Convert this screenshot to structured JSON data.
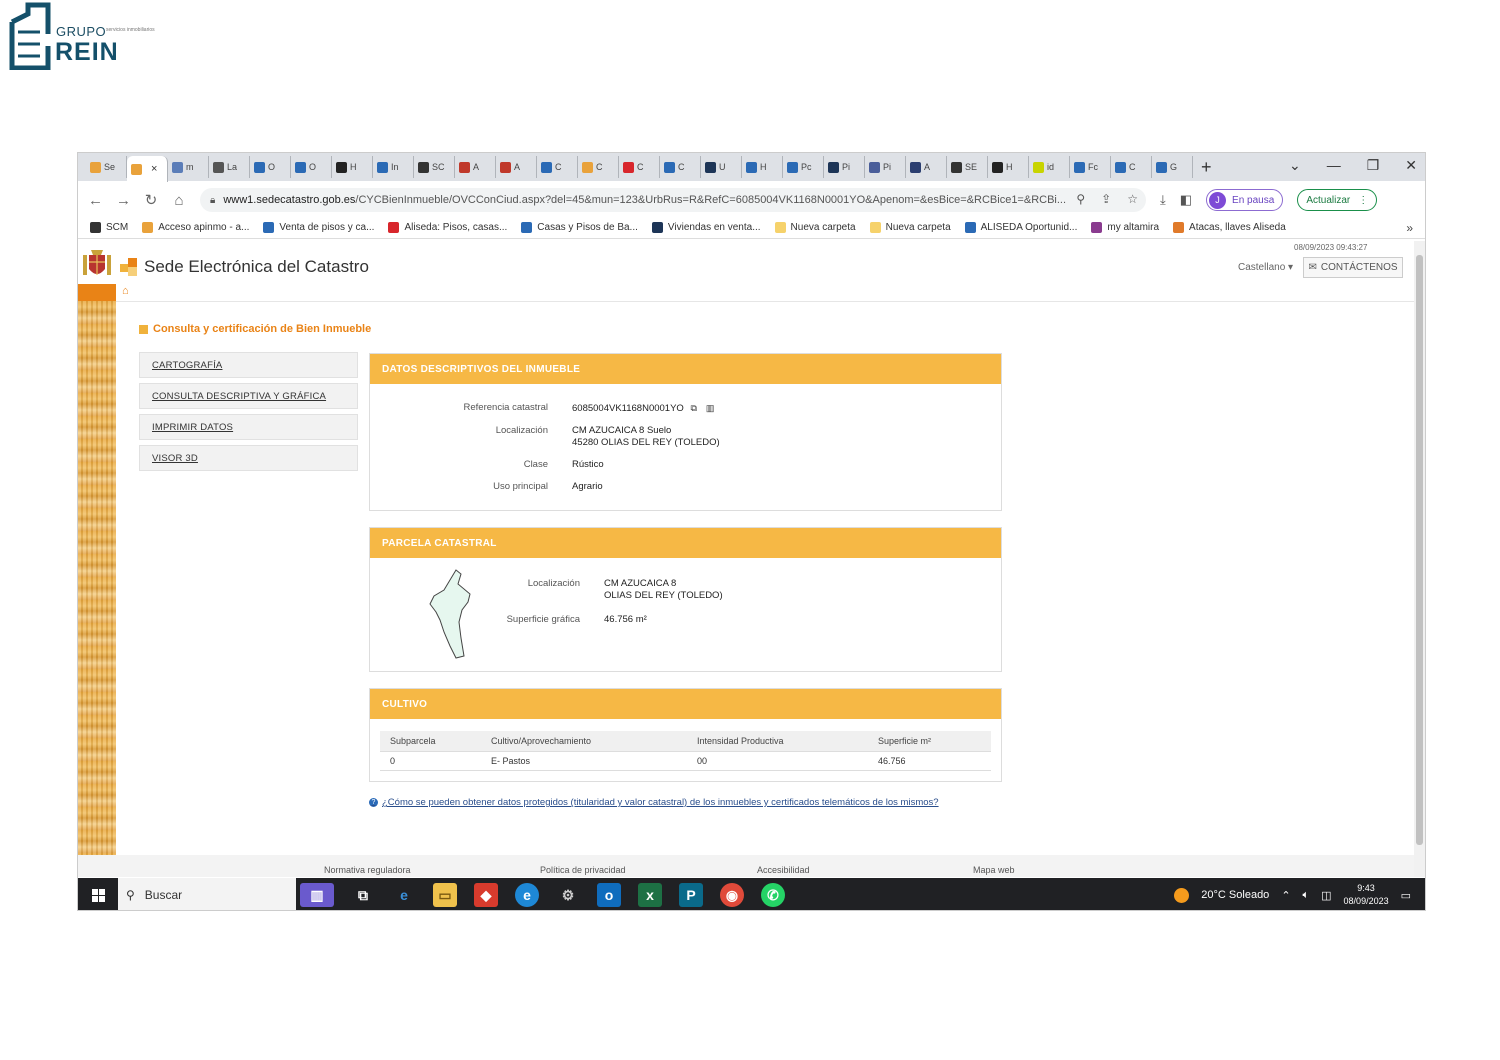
{
  "logo": {
    "grupo": "GRUPO",
    "rein": "REIN",
    "sub": "servicios inmobiliarios"
  },
  "browser": {
    "tabs": [
      {
        "label": "Se",
        "color": "#e9a23b"
      },
      {
        "label": "×",
        "color": "#e9a23b",
        "active": true
      },
      {
        "label": "m",
        "color": "#5b7db8"
      },
      {
        "label": "La",
        "color": "#555555"
      },
      {
        "label": "O",
        "color": "#2b6ab5"
      },
      {
        "label": "O",
        "color": "#2b6ab5"
      },
      {
        "label": "H",
        "color": "#222222"
      },
      {
        "label": "In",
        "color": "#2b6ab5"
      },
      {
        "label": "SC",
        "color": "#333333"
      },
      {
        "label": "A",
        "color": "#c0392b"
      },
      {
        "label": "A",
        "color": "#c0392b"
      },
      {
        "label": "C",
        "color": "#2b6ab5"
      },
      {
        "label": "C",
        "color": "#e9a23b"
      },
      {
        "label": "C",
        "color": "#d8262c"
      },
      {
        "label": "C",
        "color": "#2b6ab5"
      },
      {
        "label": "U",
        "color": "#1d3557"
      },
      {
        "label": "H",
        "color": "#2b6ab5"
      },
      {
        "label": "Pc",
        "color": "#2b6ab5"
      },
      {
        "label": "Pi",
        "color": "#1d3557"
      },
      {
        "label": "Pi",
        "color": "#4a5e9a"
      },
      {
        "label": "A",
        "color": "#2b3e70"
      },
      {
        "label": "SE",
        "color": "#333333"
      },
      {
        "label": "H",
        "color": "#222222"
      },
      {
        "label": "id",
        "color": "#c8d400"
      },
      {
        "label": "Fc",
        "color": "#2b6ab5"
      },
      {
        "label": "C",
        "color": "#2b6ab5"
      },
      {
        "label": "G",
        "color": "#2b6ab5"
      }
    ],
    "new_tab": "+",
    "window_controls": [
      "⌄",
      "—",
      "❐",
      "✕"
    ],
    "url_host": "www1.sedecatastro.gob.es",
    "url_path": "/CYCBienInmueble/OVCConCiud.aspx?del=45&mun=123&UrbRus=R&RefC=6085004VK1168N0001YO&Apenom=&esBice=&RCBice1=&RCBi...",
    "profile_initial": "J",
    "profile_label": "En pausa",
    "update_label": "Actualizar",
    "bookmarks": [
      {
        "label": "SCM",
        "color": "#333333"
      },
      {
        "label": "Acceso apinmo - a...",
        "color": "#e9a23b"
      },
      {
        "label": "Venta de pisos y ca...",
        "color": "#2b6ab5"
      },
      {
        "label": "Aliseda: Pisos, casas...",
        "color": "#d8262c"
      },
      {
        "label": "Casas y Pisos de Ba...",
        "color": "#2b6ab5"
      },
      {
        "label": "Viviendas en venta...",
        "color": "#1d3557"
      },
      {
        "label": "Nueva carpeta",
        "color": "#f6d26b"
      },
      {
        "label": "Nueva carpeta",
        "color": "#f6d26b"
      },
      {
        "label": "ALISEDA Oportunid...",
        "color": "#2b6ab5"
      },
      {
        "label": "my altamira",
        "color": "#8a3b8f"
      },
      {
        "label": "Atacas, llaves Aliseda",
        "color": "#e07a2a"
      }
    ],
    "bookmarks_more": "»"
  },
  "catastro": {
    "datetime": "08/09/2023 09:43:27",
    "site_title": "Sede Electrónica del Catastro",
    "language": "Castellano",
    "contact": "CONTÁCTENOS",
    "section_title": "Consulta y certificación de Bien Inmueble",
    "nav": [
      "CARTOGRAFÍA",
      "CONSULTA DESCRIPTIVA Y GRÁFICA",
      "IMPRIMIR DATOS",
      "VISOR 3D"
    ],
    "datos": {
      "header": "DATOS DESCRIPTIVOS DEL INMUEBLE",
      "ref_label": "Referencia catastral",
      "ref_value": "6085004VK1168N0001YO",
      "loc_label": "Localización",
      "loc_line1": "CM AZUCAICA 8 Suelo",
      "loc_line2": "45280 OLIAS DEL REY (TOLEDO)",
      "clase_label": "Clase",
      "clase_value": "Rústico",
      "uso_label": "Uso principal",
      "uso_value": "Agrario"
    },
    "parcela": {
      "header": "PARCELA CATASTRAL",
      "loc_label": "Localización",
      "loc_line1": "CM AZUCAICA 8",
      "loc_line2": "OLIAS DEL REY (TOLEDO)",
      "sup_label": "Superficie gráfica",
      "sup_value": "46.756 m²"
    },
    "cultivo": {
      "header": "CULTIVO",
      "columns": [
        "Subparcela",
        "Cultivo/Aprovechamiento",
        "Intensidad Productiva",
        "Superficie m²"
      ],
      "rows": [
        [
          "0",
          "E- Pastos",
          "00",
          "46.756"
        ]
      ]
    },
    "help_link": "¿Cómo se pueden obtener datos protegidos (titularidad y valor catastral) de los inmuebles y certificados telemáticos de los mismos?",
    "footer": [
      "Normativa reguladora",
      "Política de privacidad",
      "Accesibilidad",
      "Mapa web"
    ]
  },
  "taskbar": {
    "search": "Buscar",
    "weather": "20°C  Soleado",
    "time": "9:43",
    "date": "08/09/2023"
  }
}
